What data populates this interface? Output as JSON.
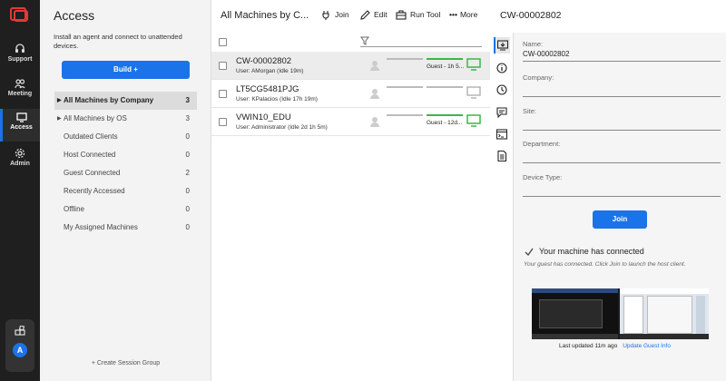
{
  "rail": {
    "items": [
      {
        "label": "Support",
        "icon": "headset-icon"
      },
      {
        "label": "Meeting",
        "icon": "people-icon"
      },
      {
        "label": "Access",
        "icon": "monitor-icon"
      },
      {
        "label": "Admin",
        "icon": "gear-icon"
      }
    ],
    "avatar": "A"
  },
  "sidebar": {
    "title": "Access",
    "description": "Install an agent and connect to unattended devices.",
    "build_label": "Build +",
    "items": [
      {
        "label": "All Machines by Company",
        "count": "3",
        "expandable": true
      },
      {
        "label": "All Machines by OS",
        "count": "3",
        "expandable": true
      },
      {
        "label": "Outdated Clients",
        "count": "0"
      },
      {
        "label": "Host Connected",
        "count": "0"
      },
      {
        "label": "Guest Connected",
        "count": "2"
      },
      {
        "label": "Recently Accessed",
        "count": "0"
      },
      {
        "label": "Offline",
        "count": "0"
      },
      {
        "label": "My Assigned Machines",
        "count": "0"
      }
    ],
    "create_label": "+ Create Session Group"
  },
  "list": {
    "title": "All Machines by C...",
    "toolbar": {
      "join": "Join",
      "edit": "Edit",
      "run_tool": "Run Tool",
      "more": "More"
    },
    "rows": [
      {
        "name": "CW-00002802",
        "user": "User: AMorgan (Idle 19m)",
        "guest": "Guest - 1h 5...",
        "online": true
      },
      {
        "name": "LT5CG5481PJG",
        "user": "User: KPalacios (Idle 17h 19m)",
        "guest": "",
        "online": false
      },
      {
        "name": "VWIN10_EDU",
        "user": "User: Administrator (Idle 2d 1h 5m)",
        "guest": "Guest - 12d...",
        "online": true
      }
    ]
  },
  "detail": {
    "machine_name": "CW-00002802",
    "fields": [
      {
        "label": "Name:",
        "value": "CW-00002802"
      },
      {
        "label": "Company:",
        "value": ""
      },
      {
        "label": "Site:",
        "value": ""
      },
      {
        "label": "Department:",
        "value": ""
      },
      {
        "label": "Device Type:",
        "value": ""
      }
    ],
    "join_label": "Join",
    "connected_title": "Your machine has connected",
    "connected_note": "Your guest has connected. Click Join to launch the host client.",
    "last_updated": "Last updated 11m ago",
    "update_link": "Update Guest Info"
  },
  "colors": {
    "accent": "#1a73e8",
    "online": "#3cb54a",
    "brand": "#e53935",
    "rail": "#1f1f1f"
  }
}
